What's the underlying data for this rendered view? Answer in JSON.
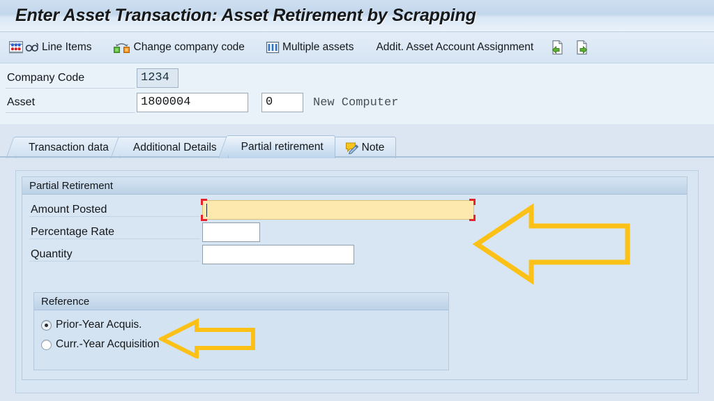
{
  "window": {
    "title": "Enter Asset Transaction: Asset Retirement by Scrapping"
  },
  "toolbar": {
    "items": [
      {
        "label": "Line Items",
        "icons": [
          "line-items-icon",
          "glasses-icon"
        ]
      },
      {
        "label": "Change company code",
        "icons": [
          "change-company-code-icon"
        ]
      },
      {
        "label": "Multiple assets",
        "icons": [
          "multiple-assets-icon"
        ]
      },
      {
        "label": "Addit. Asset Account Assignment",
        "icons": []
      }
    ],
    "trailing_icons": [
      "document-import-icon",
      "document-export-icon"
    ]
  },
  "header_fields": {
    "company_code": {
      "label": "Company Code",
      "value": "1234"
    },
    "asset": {
      "label": "Asset",
      "value": "1800004",
      "subnumber": "0",
      "description": "New Computer"
    }
  },
  "tabs": [
    {
      "label": "Transaction data",
      "active": false,
      "icon": ""
    },
    {
      "label": "Additional Details",
      "active": false,
      "icon": ""
    },
    {
      "label": "Partial retirement",
      "active": true,
      "icon": ""
    },
    {
      "label": "Note",
      "active": false,
      "icon": "note-pencil-icon"
    }
  ],
  "partial_retirement": {
    "group_title": "Partial Retirement",
    "fields": [
      {
        "label": "Amount Posted",
        "value": "",
        "focused": true,
        "required": true
      },
      {
        "label": "Percentage Rate",
        "value": "",
        "focused": false,
        "required": false
      },
      {
        "label": "Quantity",
        "value": "",
        "focused": false,
        "required": false
      }
    ],
    "reference": {
      "group_title": "Reference",
      "options": [
        {
          "label": "Prior-Year Acquis.",
          "selected": true
        },
        {
          "label": "Curr.-Year Acquisition",
          "selected": false
        }
      ]
    }
  },
  "annotations": [
    {
      "name": "amount-posted-arrow",
      "direction": "left",
      "color": "#FBC117"
    },
    {
      "name": "reference-arrow",
      "direction": "left",
      "color": "#FBC117"
    }
  ],
  "colors": {
    "title_bar": "#c9dcef",
    "toolbar": "#dce9f6",
    "content_bg": "#dbe6f2",
    "group_bg": "#d4e3f1",
    "required_field": "#fde9ad",
    "focus_marker": "#e4262c",
    "annotation": "#FBC117"
  }
}
